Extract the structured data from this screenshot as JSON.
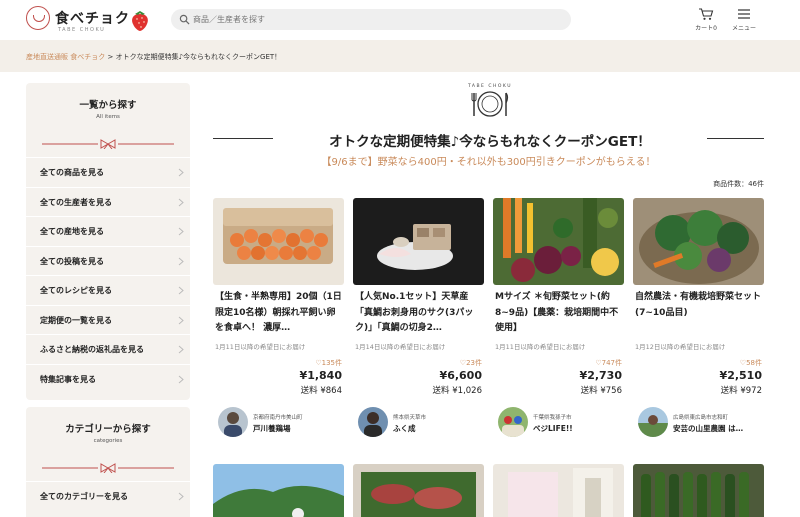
{
  "header": {
    "logo_text": "食べチョク",
    "logo_sub": "TABE CHOKU",
    "search_placeholder": "商品／生産者を探す",
    "cart_label": "カート0",
    "menu_label": "メニュー"
  },
  "breadcrumb": {
    "home": "産地直送通販 食べチョク",
    "separator": ">",
    "current": "オトクな定期便特集♪今ならもれなくクーポンGET！"
  },
  "sidebar": {
    "panel1": {
      "title": "一覧から探す",
      "subtitle": "All items",
      "items": [
        {
          "label": "全ての商品を見る"
        },
        {
          "label": "全ての生産者を見る"
        },
        {
          "label": "全ての産地を見る"
        },
        {
          "label": "全ての投稿を見る"
        },
        {
          "label": "全てのレシピを見る"
        },
        {
          "label": "定期便の一覧を見る"
        },
        {
          "label": "ふるさと納税の返礼品を見る"
        },
        {
          "label": "特集記事を見る"
        }
      ]
    },
    "panel2": {
      "title": "カテゴリーから探す",
      "subtitle": "categories",
      "items": [
        {
          "label": "全てのカテゴリーを見る"
        }
      ]
    }
  },
  "main": {
    "logo_small": "TABE CHOKU",
    "title": "オトクな定期便特集♪今ならもれなくクーポンGET！",
    "subtitle": "【9/6まで】野菜なら400円・それ以外も300円引きクーポンがもらえる！",
    "item_count": "商品件数：46件"
  },
  "products": [
    {
      "title": "【生食・半熟専用】20個（1日限定10名様）朝採れ平飼い卵を食卓へ！ 濃厚…",
      "delivery": "1月11日以降の希望日にお届け",
      "likes": "135件",
      "price": "¥1,840",
      "shipping": "送料 ¥864",
      "producer_location": "京都府南丹市美山町",
      "producer_name": "戸川養鶏場"
    },
    {
      "title": "【人気No.1セット】天草産「真鯛お刺身用のサク(3パック)」「真鯛の切身2…",
      "delivery": "1月14日以降の希望日にお届け",
      "likes": "23件",
      "price": "¥6,600",
      "shipping": "送料 ¥1,026",
      "producer_location": "熊本県天草市",
      "producer_name": "ふく成"
    },
    {
      "title": "Mサイズ ＊旬野菜セット(約8~9品)【農薬：栽培期間中不使用】",
      "delivery": "1月11日以降の希望日にお届け",
      "likes": "747件",
      "price": "¥2,730",
      "shipping": "送料 ¥756",
      "producer_location": "千葉県我孫子市",
      "producer_name": "ベジLIFE!!"
    },
    {
      "title": "自然農法・有機栽培野菜セット(7~10品目)",
      "delivery": "1月12日以降の希望日にお届け",
      "likes": "58件",
      "price": "¥2,510",
      "shipping": "送料 ¥972",
      "producer_location": "広島県東広島市志和町",
      "producer_name": "安芸の山里農園 は…"
    }
  ],
  "colors": {
    "accent": "#c98a5a",
    "ribbon": "#c0504d",
    "panel_bg": "#f5f2ee",
    "breadcrumb_bg": "#f3efe9"
  },
  "icons": {
    "search": "search-icon",
    "cart": "cart-icon",
    "menu": "hamburger-icon",
    "chevron": "chevron-right-icon",
    "heart": "heart-outline-icon"
  }
}
